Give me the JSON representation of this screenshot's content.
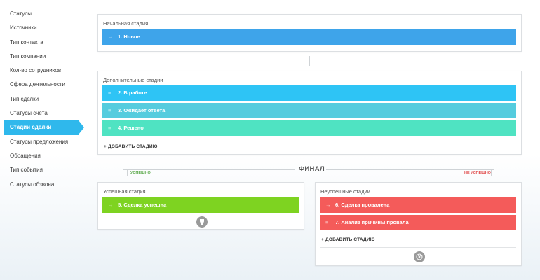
{
  "sidebar": {
    "items": [
      {
        "label": "Статусы"
      },
      {
        "label": "Источники"
      },
      {
        "label": "Тип контакта"
      },
      {
        "label": "Тип компании"
      },
      {
        "label": "Кол-во сотрудников"
      },
      {
        "label": "Сфера деятельности"
      },
      {
        "label": "Тип сделки"
      },
      {
        "label": "Статусы счёта"
      },
      {
        "label": "Стадии сделки"
      },
      {
        "label": "Статусы предложения"
      },
      {
        "label": "Обращения"
      },
      {
        "label": "Тип события"
      },
      {
        "label": "Статусы обзвона"
      }
    ],
    "active_index": 8
  },
  "initial": {
    "title": "Начальная стадия",
    "stage": {
      "label": "1. Новое",
      "color": "#3ea4ea",
      "icon": "arrow-right-icon"
    }
  },
  "additional": {
    "title": "Дополнительные стадии",
    "stages": [
      {
        "label": "2. В работе",
        "color": "#2ec4f5",
        "icon": "drag-handle-icon"
      },
      {
        "label": "3. Ожидает ответа",
        "color": "#55ccde",
        "icon": "drag-handle-icon"
      },
      {
        "label": "4. Решено",
        "color": "#4fe3c2",
        "icon": "drag-handle-icon"
      }
    ],
    "add_label": "+ ДОБАВИТЬ СТАДИЮ"
  },
  "final": {
    "title": "ФИНАЛ",
    "success_tag": "УСПЕШНО",
    "fail_tag": "НЕ УСПЕШНО",
    "success_color": "#5aa84a",
    "fail_color": "#e04b4b"
  },
  "success": {
    "title": "Успешная стадия",
    "stage": {
      "label": "5. Сделка успешна",
      "color": "#7ed321",
      "icon": "arrow-right-icon"
    },
    "button_icon": "trophy-icon"
  },
  "failure": {
    "title": "Неуспешные стадии",
    "stages": [
      {
        "label": "6. Сделка провалена",
        "color": "#f45b5a",
        "icon": "arrow-right-icon"
      },
      {
        "label": "7. Анализ причины провала",
        "color": "#f45b5a",
        "icon": "drag-handle-icon"
      }
    ],
    "add_label": "+ ДОБАВИТЬ СТАДИЮ",
    "button_icon": "close-circle-icon"
  }
}
